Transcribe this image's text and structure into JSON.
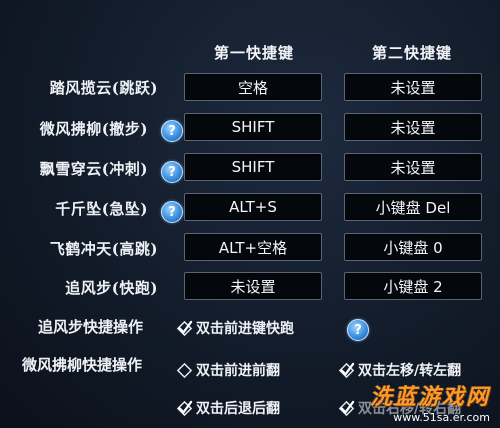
{
  "headers": {
    "first": "第一快捷键",
    "second": "第二快捷键"
  },
  "rows": [
    {
      "label": "踏风揽云(跳跃)",
      "first": "空格",
      "second": "未设置",
      "help": false
    },
    {
      "label": "微风拂柳(撤步)",
      "first": "SHIFT",
      "second": "未设置",
      "help": true
    },
    {
      "label": "飘雪穿云(冲刺)",
      "first": "SHIFT",
      "second": "未设置",
      "help": true
    },
    {
      "label": "千斤坠(急坠)",
      "first": "ALT+S",
      "second": "小键盘 Del",
      "help": true
    },
    {
      "label": "飞鹤冲天(高跳)",
      "first": "ALT+空格",
      "second": "小键盘 0",
      "help": false
    },
    {
      "label": "追风步(快跑)",
      "first": "未设置",
      "second": "小键盘 2",
      "help": false
    }
  ],
  "help_glyph": "?",
  "options": {
    "zhuifeng_label": "追风步快捷操作",
    "zhuifeng_opt1": {
      "text": "双击前进键快跑",
      "checked": true
    },
    "weifeng_label": "微风拂柳快捷操作",
    "weifeng_opt1": {
      "text": "双击前进前翻",
      "checked": false
    },
    "weifeng_opt2": {
      "text": "双击左移/转左翻",
      "checked": true
    },
    "weifeng_opt3": {
      "text": "双击后退后翻",
      "checked": true
    },
    "weifeng_opt4": {
      "text": "双击右移/转右翻",
      "checked": true
    }
  },
  "watermark": {
    "main": "洗蓝游戏网",
    "url": "www.51sa.er.com"
  },
  "colors": {
    "help_blue": "#3b8fde",
    "watermark_orange": "#ff9a2a",
    "key_bg": "#04070c"
  }
}
